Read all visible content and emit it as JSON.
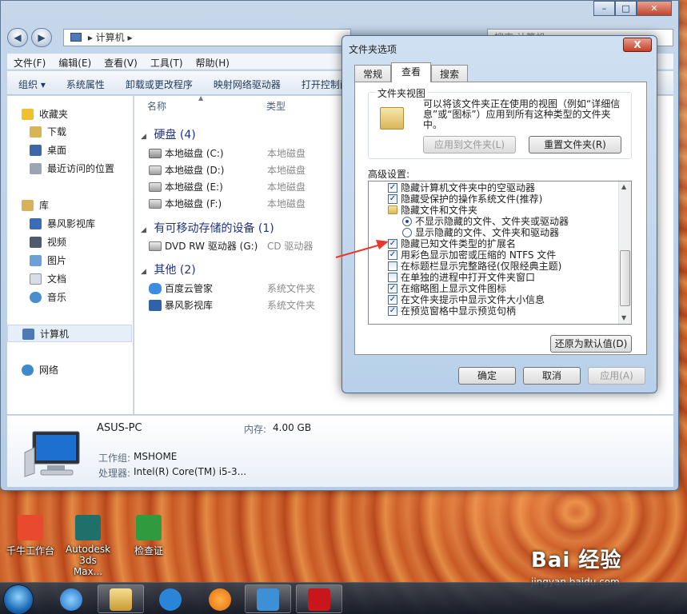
{
  "explorer": {
    "address": "计算机",
    "search_placeholder": "搜索 计算机",
    "menus": [
      "文件(F)",
      "编辑(E)",
      "查看(V)",
      "工具(T)",
      "帮助(H)"
    ],
    "toolbar": [
      "组织 ▾",
      "系统属性",
      "卸载或更改程序",
      "映射网络驱动器",
      "打开控制面板"
    ],
    "sidebar": {
      "favorites": "收藏夹",
      "favorites_items": [
        "下载",
        "桌面",
        "最近访问的位置"
      ],
      "libraries": "库",
      "library_items": [
        "暴风影视库",
        "视频",
        "图片",
        "文档",
        "音乐"
      ],
      "computer": "计算机",
      "network": "网络"
    },
    "columns": {
      "name": "名称",
      "type": "类型"
    },
    "groups": {
      "hdd": "硬盘 (4)",
      "removable": "有可移动存储的设备 (1)",
      "other": "其他 (2)"
    },
    "drives": [
      {
        "name": "本地磁盘 (C:)",
        "type": "本地磁盘"
      },
      {
        "name": "本地磁盘 (D:)",
        "type": "本地磁盘"
      },
      {
        "name": "本地磁盘 (E:)",
        "type": "本地磁盘"
      },
      {
        "name": "本地磁盘 (F:)",
        "type": "本地磁盘"
      }
    ],
    "removable": [
      {
        "name": "DVD RW 驱动器 (G:)",
        "type": "CD 驱动器"
      }
    ],
    "others": [
      {
        "name": "百度云管家",
        "type": "系统文件夹"
      },
      {
        "name": "暴风影视库",
        "type": "系统文件夹"
      }
    ],
    "details": {
      "pc_name": "ASUS-PC",
      "memory_label": "内存:",
      "memory_value": "4.00 GB",
      "workgroup_label": "工作组:",
      "workgroup_value": "MSHOME",
      "cpu_label": "处理器:",
      "cpu_value": "Intel(R) Core(TM) i5-3..."
    }
  },
  "dialog": {
    "title": "文件夹选项",
    "close": "X",
    "tabs": [
      "常规",
      "查看",
      "搜索"
    ],
    "folder_view_legend": "文件夹视图",
    "folder_view_desc": "可以将该文件夹正在使用的视图（例如“详细信息”或“图标”）应用到所有这种类型的文件夹中。",
    "apply_to_folders": "应用到文件夹(L)",
    "reset_folders": "重置文件夹(R)",
    "advanced_label": "高级设置:",
    "settings": [
      {
        "kind": "check",
        "checked": true,
        "label": "隐藏计算机文件夹中的空驱动器"
      },
      {
        "kind": "check",
        "checked": true,
        "label": "隐藏受保护的操作系统文件(推荐)"
      },
      {
        "kind": "folder",
        "label": "隐藏文件和文件夹"
      },
      {
        "kind": "radio",
        "checked": true,
        "label": "不显示隐藏的文件、文件夹或驱动器"
      },
      {
        "kind": "radio",
        "checked": false,
        "label": "显示隐藏的文件、文件夹和驱动器"
      },
      {
        "kind": "check",
        "checked": true,
        "label": "隐藏已知文件类型的扩展名"
      },
      {
        "kind": "check",
        "checked": true,
        "label": "用彩色显示加密或压缩的 NTFS 文件"
      },
      {
        "kind": "check",
        "checked": false,
        "label": "在标题栏显示完整路径(仅限经典主题)"
      },
      {
        "kind": "check",
        "checked": false,
        "label": "在单独的进程中打开文件夹窗口"
      },
      {
        "kind": "check",
        "checked": true,
        "label": "在缩略图上显示文件图标"
      },
      {
        "kind": "check",
        "checked": true,
        "label": "在文件夹提示中显示文件大小信息"
      },
      {
        "kind": "check",
        "checked": true,
        "label": "在预览窗格中显示预览句柄"
      }
    ],
    "restore_defaults": "还原为默认值(D)",
    "ok": "确定",
    "cancel": "取消",
    "apply": "应用(A)"
  },
  "desktop_icons": [
    "千牛工作台",
    "Autodesk 3ds Max...",
    "检查证"
  ],
  "watermark": {
    "main": "Bai 经验",
    "url": "jingyan.baidu.com"
  }
}
